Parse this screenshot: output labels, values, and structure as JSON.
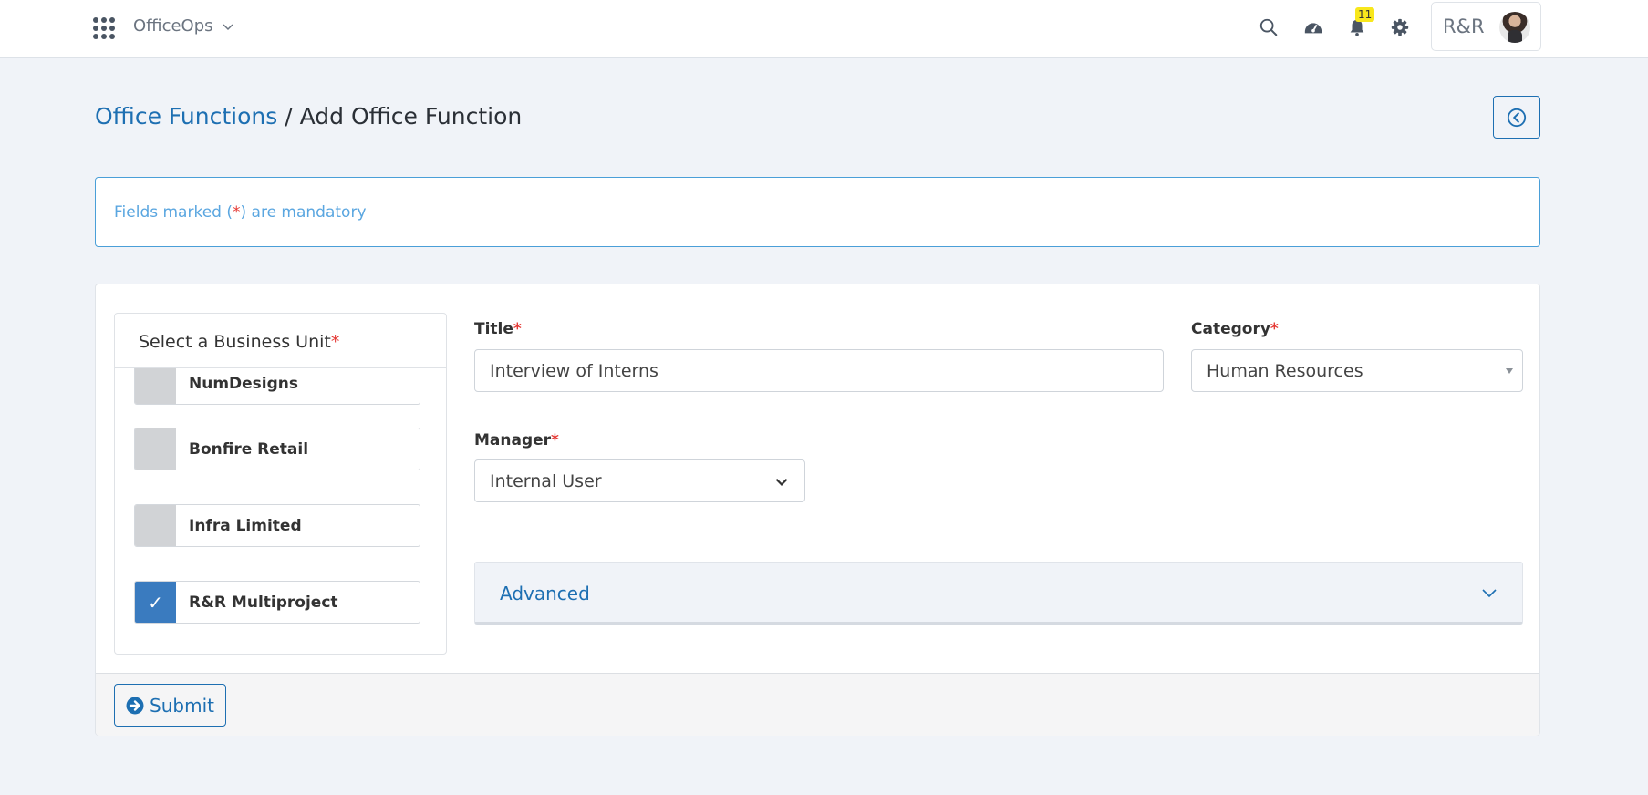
{
  "topbar": {
    "app_name": "OfficeOps",
    "notification_count": "11",
    "user_label": "R&R",
    "icons": [
      "apps-grid-icon",
      "search-icon",
      "dashboard-gauge-icon",
      "bell-icon",
      "gear-icon"
    ]
  },
  "breadcrumb": {
    "parent": "Office Functions",
    "separator": " / ",
    "current": "Add Office Function"
  },
  "alert": {
    "prefix": "Fields marked (",
    "asterisk": "*",
    "suffix": ") are mandatory"
  },
  "business_unit": {
    "heading": "Select a Business Unit",
    "required_mark": "*",
    "items": [
      {
        "label": "NumDesigns",
        "checked": false
      },
      {
        "label": "Bonfire Retail",
        "checked": false
      },
      {
        "label": "Infra Limited",
        "checked": false
      },
      {
        "label": "R&R Multiproject",
        "checked": true
      }
    ],
    "check_glyph": "✓"
  },
  "form": {
    "title_label": "Title",
    "title_value": "Interview of Interns",
    "category_label": "Category",
    "category_value": "Human Resources",
    "manager_label": "Manager",
    "manager_value": "Internal User",
    "required_mark": "*"
  },
  "advanced": {
    "label": "Advanced"
  },
  "submit": {
    "label": "Submit"
  },
  "colors": {
    "primary": "#1d6fb2",
    "required": "#e53935",
    "scrollbar": "#3dbf99",
    "checked": "#3a7bbf",
    "badge": "#f8e71c"
  }
}
